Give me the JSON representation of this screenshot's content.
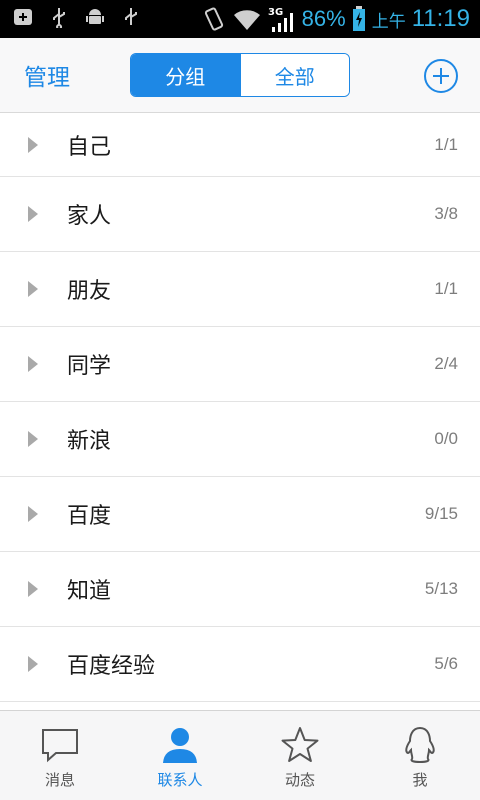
{
  "status_bar": {
    "battery_percent": "86%",
    "network": "3G",
    "am_pm": "上午",
    "time": "11:19"
  },
  "header": {
    "manage_label": "管理",
    "tabs": [
      {
        "label": "分组",
        "active": true
      },
      {
        "label": "全部",
        "active": false
      }
    ],
    "add_icon": "plus-circle-icon"
  },
  "groups": [
    {
      "name": "自己",
      "count": "1/1"
    },
    {
      "name": "家人",
      "count": "3/8"
    },
    {
      "name": "朋友",
      "count": "1/1"
    },
    {
      "name": "同学",
      "count": "2/4"
    },
    {
      "name": "新浪",
      "count": "0/0"
    },
    {
      "name": "百度",
      "count": "9/15"
    },
    {
      "name": "知道",
      "count": "5/13"
    },
    {
      "name": "百度经验",
      "count": "5/6"
    }
  ],
  "tab_bar": [
    {
      "label": "消息",
      "icon": "chat-bubble-icon",
      "active": false
    },
    {
      "label": "联系人",
      "icon": "contact-person-icon",
      "active": true
    },
    {
      "label": "动态",
      "icon": "star-icon",
      "active": false
    },
    {
      "label": "我",
      "icon": "penguin-icon",
      "active": false
    }
  ],
  "colors": {
    "accent": "#1e88e5",
    "status_text": "#35b3e6"
  }
}
